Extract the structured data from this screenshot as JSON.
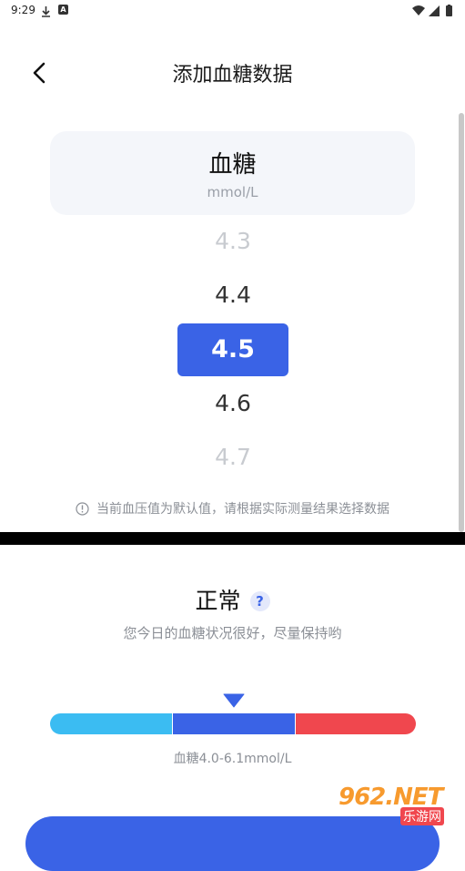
{
  "status_bar": {
    "time": "9:29",
    "icons": [
      "download-icon",
      "a-icon",
      "wifi-icon",
      "signal-icon",
      "battery-icon"
    ]
  },
  "header": {
    "title": "添加血糖数据",
    "back_icon": "chevron-left-icon"
  },
  "type_card": {
    "name": "血糖",
    "unit": "mmol/L"
  },
  "picker": {
    "items": [
      "4.3",
      "4.4",
      "4.5",
      "4.6",
      "4.7"
    ],
    "selected": "4.5"
  },
  "notice": {
    "text": "当前血压值为默认值，请根据实际测量结果选择数据",
    "icon": "info-icon"
  },
  "result": {
    "status": "正常",
    "help_icon": "?",
    "description": "您今日的血糖状况很好，尽量保持哟",
    "range_label": "血糖4.0-6.1mmol/L"
  },
  "range_colors": {
    "low": "#3bbcf2",
    "normal": "#3a63e6",
    "high": "#f0474e"
  },
  "accent_color": "#3a63e6",
  "watermark": {
    "main": "962.NET",
    "sub": "乐游网"
  }
}
